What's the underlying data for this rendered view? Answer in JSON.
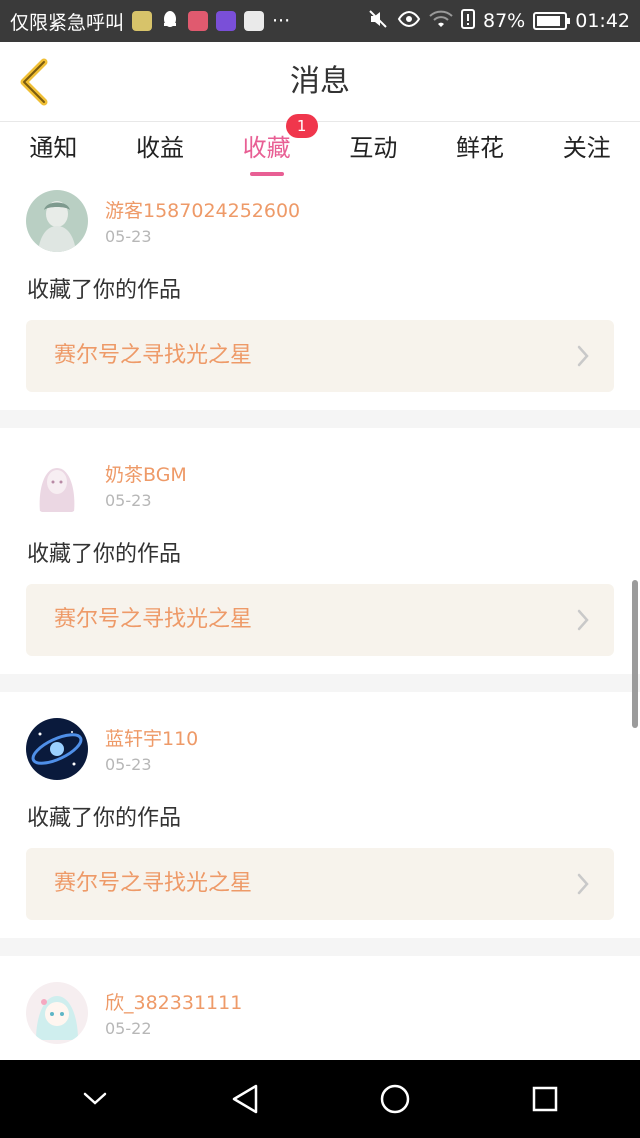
{
  "status_bar": {
    "carrier": "仅限紧急呼叫",
    "more": "···",
    "battery_percent": "87%",
    "battery_level": 0.87,
    "time": "01:42"
  },
  "header": {
    "title": "消息"
  },
  "tabs": [
    {
      "label": "通知",
      "active": false
    },
    {
      "label": "收益",
      "active": false
    },
    {
      "label": "收藏",
      "active": true,
      "badge": "1"
    },
    {
      "label": "互动",
      "active": false
    },
    {
      "label": "鲜花",
      "active": false
    },
    {
      "label": "关注",
      "active": false
    }
  ],
  "feed": [
    {
      "username": "游客1587024252600",
      "date": "05-23",
      "action": "收藏了你的作品",
      "work_title": "赛尔号之寻找光之星",
      "avatar": "ghost-avatar"
    },
    {
      "username": "奶茶BGM",
      "date": "05-23",
      "action": "收藏了你的作品",
      "work_title": "赛尔号之寻找光之星",
      "avatar": "anime-girl-avatar"
    },
    {
      "username": "蓝轩宇110",
      "date": "05-23",
      "action": "收藏了你的作品",
      "work_title": "赛尔号之寻找光之星",
      "avatar": "galaxy-avatar"
    },
    {
      "username": "欣_382331111",
      "date": "05-22",
      "action": "",
      "work_title": "",
      "avatar": "chibi-avatar"
    }
  ],
  "colors": {
    "accent_pink": "#e85f94",
    "orange_text": "#ee9a68",
    "badge_red": "#f0364c",
    "back_yellow": "#f0bf35"
  }
}
